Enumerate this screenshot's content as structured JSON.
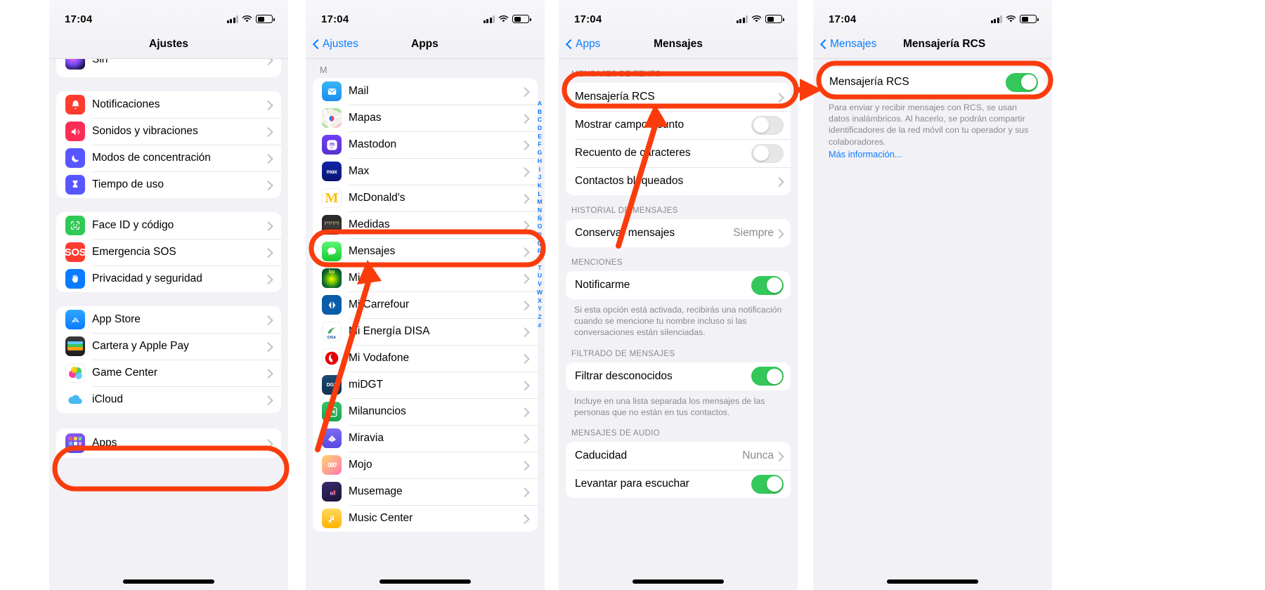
{
  "statusbar": {
    "time": "17:04"
  },
  "panel1": {
    "nav": {
      "title": "Ajustes"
    },
    "partial_group": [
      {
        "label": "Siri",
        "icon": "siri-icon",
        "accessory": "chevron"
      }
    ],
    "group2": [
      {
        "label": "Notificaciones",
        "icon": "bell-icon",
        "accessory": "chevron"
      },
      {
        "label": "Sonidos y vibraciones",
        "icon": "speaker-icon",
        "accessory": "chevron"
      },
      {
        "label": "Modos de concentración",
        "icon": "moon-icon",
        "accessory": "chevron"
      },
      {
        "label": "Tiempo de uso",
        "icon": "hourglass-icon",
        "accessory": "chevron"
      }
    ],
    "group3": [
      {
        "label": "Face ID y código",
        "icon": "faceid-icon",
        "accessory": "chevron"
      },
      {
        "label": "Emergencia SOS",
        "icon": "sos-icon",
        "accessory": "chevron"
      },
      {
        "label": "Privacidad y seguridad",
        "icon": "hand-icon",
        "accessory": "chevron"
      }
    ],
    "group4": [
      {
        "label": "App Store",
        "icon": "appstore-icon",
        "accessory": "chevron"
      },
      {
        "label": "Cartera y Apple Pay",
        "icon": "wallet-icon",
        "accessory": "chevron"
      },
      {
        "label": "Game Center",
        "icon": "gamecenter-icon",
        "accessory": "chevron"
      },
      {
        "label": "iCloud",
        "icon": "icloud-icon",
        "accessory": "chevron"
      }
    ],
    "group5": [
      {
        "label": "Apps",
        "icon": "apps-grid-icon",
        "accessory": "chevron"
      }
    ]
  },
  "panel2": {
    "nav": {
      "back": "Ajustes",
      "title": "Apps"
    },
    "section_letter": "M",
    "apps": [
      {
        "label": "Mail",
        "icon": "mail-icon"
      },
      {
        "label": "Mapas",
        "icon": "maps-icon"
      },
      {
        "label": "Mastodon",
        "icon": "mastodon-icon"
      },
      {
        "label": "Max",
        "icon": "max-icon"
      },
      {
        "label": "McDonald's",
        "icon": "mcdonalds-icon"
      },
      {
        "label": "Medidas",
        "icon": "measure-icon"
      },
      {
        "label": "Mensajes",
        "icon": "messages-icon"
      },
      {
        "label": "Mi BP",
        "icon": "bp-icon"
      },
      {
        "label": "Mi Carrefour",
        "icon": "carrefour-icon"
      },
      {
        "label": "Mi Energía DISA",
        "icon": "disa-icon"
      },
      {
        "label": "Mi Vodafone",
        "icon": "vodafone-icon"
      },
      {
        "label": "miDGT",
        "icon": "midgt-icon"
      },
      {
        "label": "Milanuncios",
        "icon": "milanuncios-icon"
      },
      {
        "label": "Miravia",
        "icon": "miravia-icon"
      },
      {
        "label": "Mojo",
        "icon": "mojo-icon"
      },
      {
        "label": "Musemage",
        "icon": "musemage-icon"
      },
      {
        "label": "Music Center",
        "icon": "musiccenter-icon"
      }
    ],
    "alpha_index": [
      "A",
      "B",
      "C",
      "D",
      "E",
      "F",
      "G",
      "H",
      "I",
      "J",
      "K",
      "L",
      "M",
      "N",
      "Ñ",
      "O",
      "P",
      "Q",
      "R",
      "S",
      "T",
      "U",
      "V",
      "W",
      "X",
      "Y",
      "Z",
      "#"
    ]
  },
  "panel3": {
    "nav": {
      "back": "Apps",
      "title": "Mensajes"
    },
    "sections": [
      {
        "header": "MENSAJES DE TEXTO",
        "rows": [
          {
            "label": "Mensajería RCS",
            "accessory": "chevron"
          },
          {
            "label": "Mostrar campo Asunto",
            "accessory": "toggle",
            "toggle_on": false
          },
          {
            "label": "Recuento de caracteres",
            "accessory": "toggle",
            "toggle_on": false
          },
          {
            "label": "Contactos bloqueados",
            "accessory": "chevron"
          }
        ]
      },
      {
        "header": "HISTORIAL DE MENSAJES",
        "rows": [
          {
            "label": "Conservar mensajes",
            "value": "Siempre",
            "accessory": "chevron"
          }
        ]
      },
      {
        "header": "MENCIONES",
        "rows": [
          {
            "label": "Notificarme",
            "accessory": "toggle",
            "toggle_on": true
          }
        ],
        "footnote": "Si esta opción está activada, recibirás una notificación cuando se mencione tu nombre incluso si las conversaciones están silenciadas."
      },
      {
        "header": "FILTRADO DE MENSAJES",
        "rows": [
          {
            "label": "Filtrar desconocidos",
            "accessory": "toggle",
            "toggle_on": true
          }
        ],
        "footnote": "Incluye en una lista separada los mensajes de las personas que no están en tus contactos."
      },
      {
        "header": "MENSAJES DE AUDIO",
        "rows": [
          {
            "label": "Caducidad",
            "value": "Nunca",
            "accessory": "chevron"
          },
          {
            "label": "Levantar para escuchar",
            "accessory": "toggle",
            "toggle_on": true
          }
        ]
      }
    ]
  },
  "panel4": {
    "nav": {
      "back": "Mensajes",
      "title": "Mensajería RCS"
    },
    "rows": [
      {
        "label": "Mensajería RCS",
        "accessory": "toggle",
        "toggle_on": true
      }
    ],
    "footnote": "Para enviar y recibir mensajes con RCS, se usan datos inalámbricos. Al hacerlo, se podrán compartir identificadores de la red móvil con tu operador y sus colaboradores.",
    "footlink": "Más información..."
  },
  "annotations": {
    "color": "#fa3c0c",
    "highlights": [
      {
        "target": "Apps",
        "panel": 1
      },
      {
        "target": "Mensajes",
        "panel": 2
      },
      {
        "target": "Mensajería RCS",
        "panel": 3
      },
      {
        "target": "Mensajería RCS",
        "panel": 4
      }
    ],
    "arrows": [
      {
        "from": "panel1 Apps row",
        "to": "panel2 Mensajes row"
      },
      {
        "from": "panel2 Mensajes row",
        "to": "panel3 Mensajería RCS row"
      },
      {
        "from": "panel3 Mensajería RCS row",
        "to": "panel4 Mensajería RCS row"
      }
    ]
  }
}
